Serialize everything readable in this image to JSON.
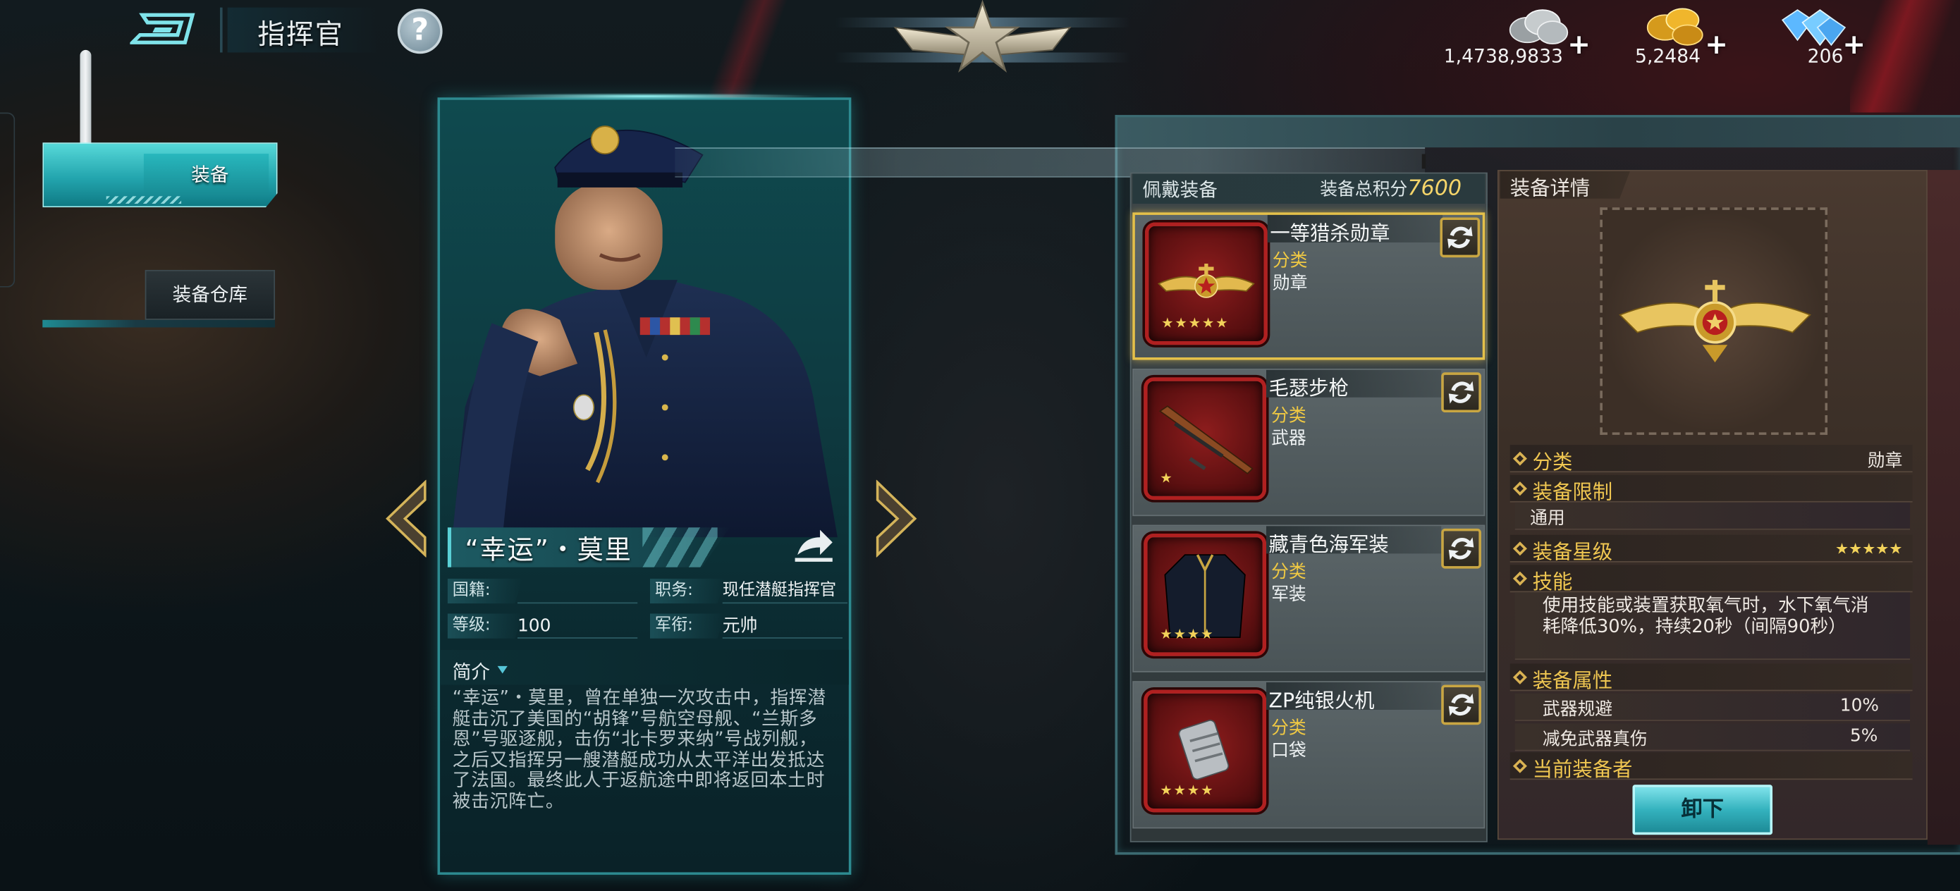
{
  "header": {
    "title": "指挥官",
    "help_label": "?",
    "currencies": [
      {
        "name": "silver-coins-icon",
        "amount": "1,4738,9833",
        "plus": "+"
      },
      {
        "name": "gold-coins-icon",
        "amount": "5,2484",
        "plus": "+"
      },
      {
        "name": "diamonds-icon",
        "amount": "206",
        "plus": "+"
      }
    ]
  },
  "sidebar": {
    "items": [
      {
        "label": "装备",
        "active": true
      },
      {
        "label": "装备仓库",
        "active": false
      }
    ]
  },
  "commander": {
    "name": "“幸运”・莫里",
    "fields": {
      "nationality_label": "国籍:",
      "nationality_value": "",
      "duty_label": "职务:",
      "duty_value": "现任潜艇指挥官",
      "level_label": "等级:",
      "level_value": "100",
      "rank_label": "军衔:",
      "rank_value": "元帅"
    },
    "intro_title": "简介",
    "intro_text": "“幸运”・莫里，曾在单独一次攻击中，指挥潜艇击沉了美国的“胡锋”号航空母舰、“兰斯多恩”号驱逐舰，击伤“北卡罗来纳”号战列舰，之后又指挥另一艘潜艇成功从太平洋出发抵达了法国。最终此人于返航途中即将返回本土时被击沉阵亡。"
  },
  "equipped": {
    "title": "佩戴装备",
    "score_label": "装备总积分",
    "score_value": "7600",
    "category_label": "分类",
    "items": [
      {
        "name": "一等猎杀勋章",
        "category": "勋章",
        "stars": "★★★★★",
        "icon": "medal-icon",
        "selected": true
      },
      {
        "name": "毛瑟步枪",
        "category": "武器",
        "stars": "★",
        "icon": "rifle-icon",
        "selected": false
      },
      {
        "name": "藏青色海军装",
        "category": "军装",
        "stars": "★★★★",
        "icon": "uniform-icon",
        "selected": false
      },
      {
        "name": "ZP纯银火机",
        "category": "口袋",
        "stars": "★★★★",
        "icon": "lighter-icon",
        "selected": false
      }
    ]
  },
  "details": {
    "title": "装备详情",
    "category_label": "分类",
    "category_value": "勋章",
    "limit_label": "装备限制",
    "limit_value": "通用",
    "star_label": "装备星级",
    "star_value": "★★★★★",
    "skill_label": "技能",
    "skill_text": "使用技能或装置获取氧气时，水下氧气消耗降低30%，持续20秒（间隔90秒）",
    "attr_label": "装备属性",
    "attrs": [
      {
        "name": "武器规避",
        "value": "10%"
      },
      {
        "name": "减免武器真伤",
        "value": "5%"
      }
    ],
    "holder_label": "当前装备者",
    "unequip_label": "卸下"
  },
  "colors": {
    "accent_teal": "#23a5ae",
    "gold_label": "#efc651",
    "item_border_red": "#b02020",
    "selected_border": "#e4c04a"
  }
}
